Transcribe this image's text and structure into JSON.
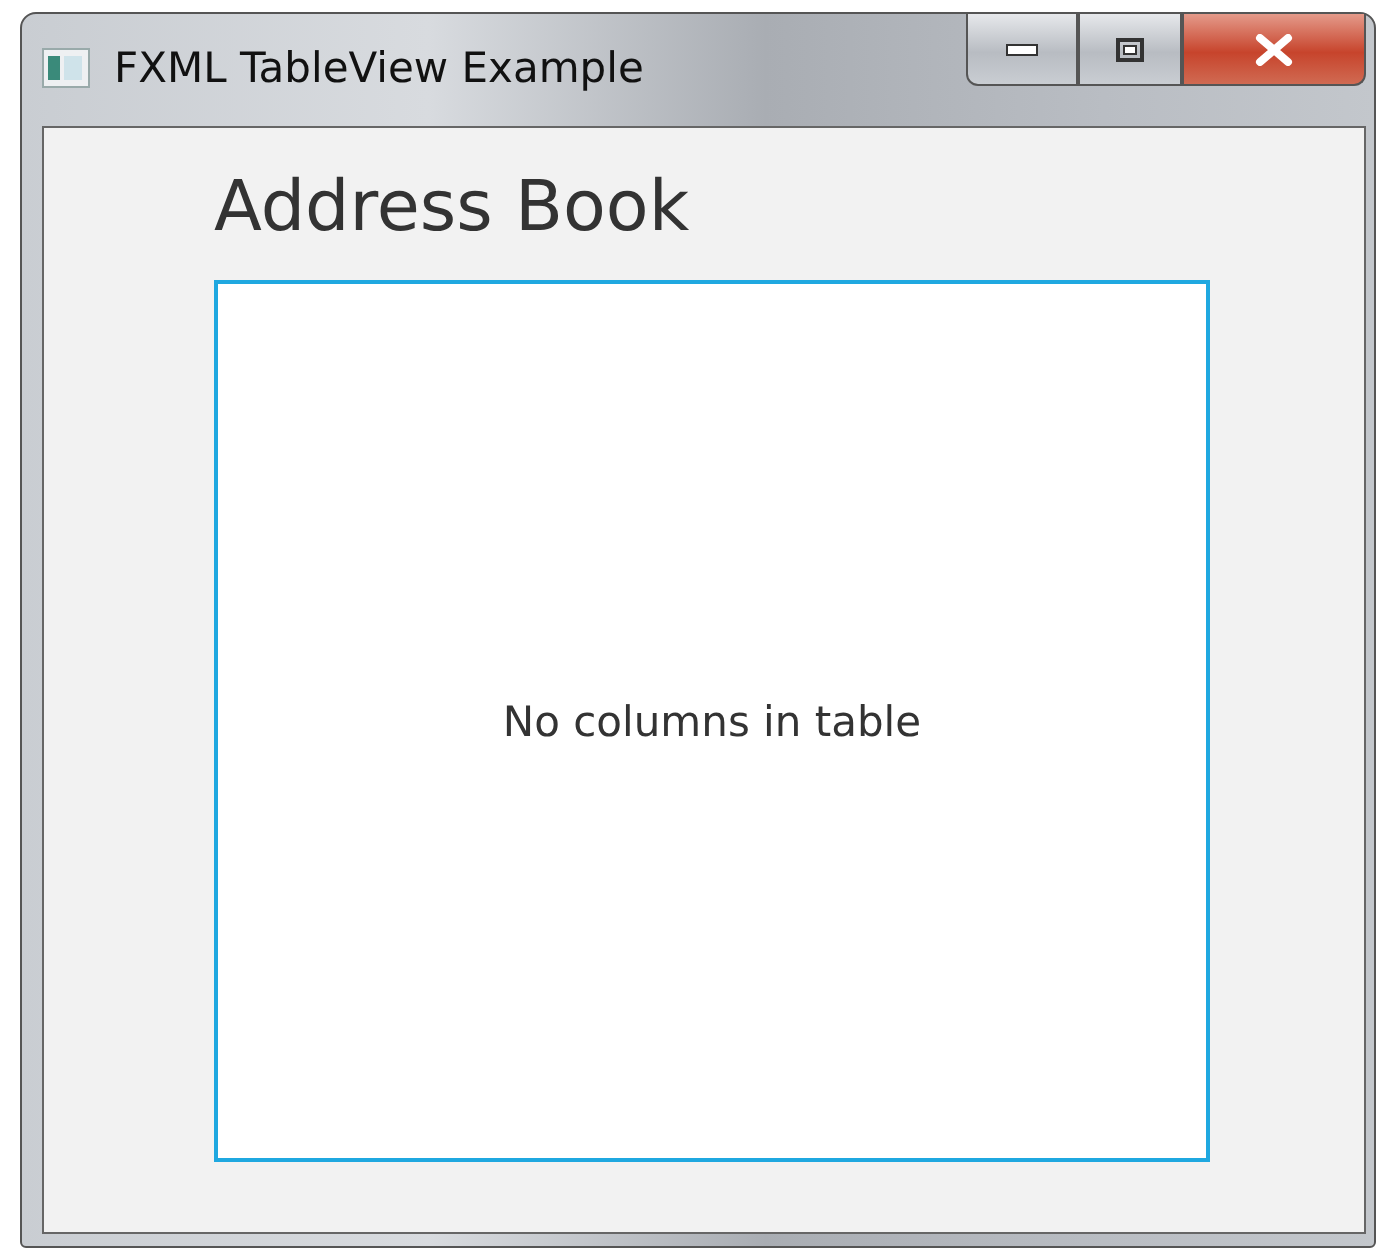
{
  "window": {
    "title": "FXML TableView Example"
  },
  "heading": "Address Book",
  "table": {
    "placeholder": "No columns in table",
    "focused": true
  }
}
